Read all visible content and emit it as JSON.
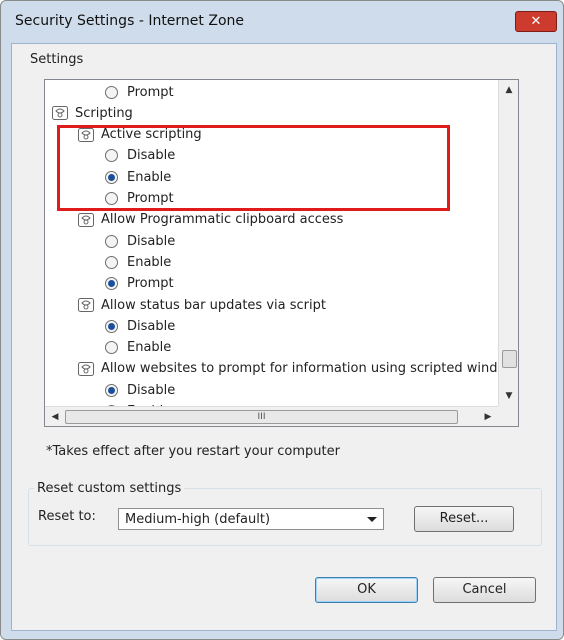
{
  "window": {
    "title": "Security Settings - Internet Zone",
    "close_label": "✕"
  },
  "settings": {
    "label": "Settings",
    "rows": [
      {
        "kind": "radio",
        "label": "Prompt",
        "checked": false
      },
      {
        "kind": "group",
        "label": "Scripting"
      },
      {
        "kind": "setting",
        "label": "Active scripting"
      },
      {
        "kind": "radio",
        "label": "Disable",
        "checked": false
      },
      {
        "kind": "radio",
        "label": "Enable",
        "checked": true
      },
      {
        "kind": "radio",
        "label": "Prompt",
        "checked": false
      },
      {
        "kind": "setting",
        "label": "Allow Programmatic clipboard access"
      },
      {
        "kind": "radio",
        "label": "Disable",
        "checked": false
      },
      {
        "kind": "radio",
        "label": "Enable",
        "checked": false
      },
      {
        "kind": "radio",
        "label": "Prompt",
        "checked": true
      },
      {
        "kind": "setting",
        "label": "Allow status bar updates via script"
      },
      {
        "kind": "radio",
        "label": "Disable",
        "checked": true
      },
      {
        "kind": "radio",
        "label": "Enable",
        "checked": false
      },
      {
        "kind": "setting",
        "label": "Allow websites to prompt for information using scripted windo"
      },
      {
        "kind": "radio",
        "label": "Disable",
        "checked": true
      },
      {
        "kind": "radio",
        "label": "Enable",
        "checked": false
      }
    ],
    "hscroll_grip": "III",
    "note": "*Takes effect after you restart your computer"
  },
  "reset": {
    "group_label": "Reset custom settings",
    "reset_to_label": "Reset to:",
    "level_value": "Medium-high (default)",
    "reset_button": "Reset..."
  },
  "buttons": {
    "ok": "OK",
    "cancel": "Cancel"
  },
  "colors": {
    "highlight": "#e01b1b",
    "radio_selected": "#1b4f9c"
  }
}
